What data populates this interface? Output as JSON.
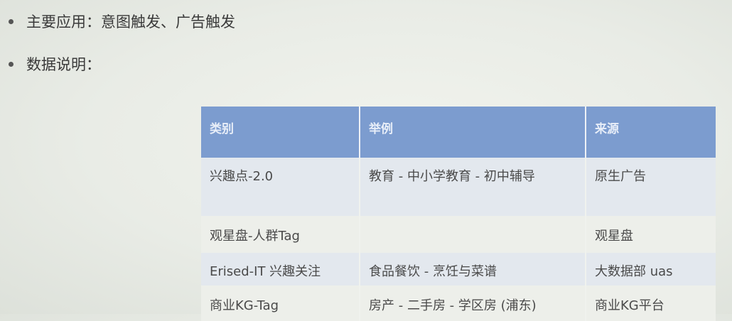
{
  "bullets": [
    {
      "text": "主要应用：意图触发、广告触发"
    },
    {
      "text": "数据说明："
    }
  ],
  "table": {
    "headers": [
      "类别",
      "举例",
      "来源"
    ],
    "rows": [
      [
        "兴趣点-2.0",
        "教育 - 中小学教育 - 初中辅导",
        "原生广告"
      ],
      [
        "观星盘-人群Tag",
        "",
        "观星盘"
      ],
      [
        "Erised-IT 兴趣关注",
        "食品餐饮 - 烹饪与菜谱",
        "大数据部 uas"
      ],
      [
        "商业KG-Tag",
        "房产 - 二手房 - 学区房 (浦东)",
        "商业KG平台"
      ]
    ]
  },
  "colors": {
    "header_bg": "#7c9ccf",
    "header_text": "#e8eef8",
    "row_bg_a": "#e3e8ee",
    "row_bg_b": "#edefea"
  }
}
